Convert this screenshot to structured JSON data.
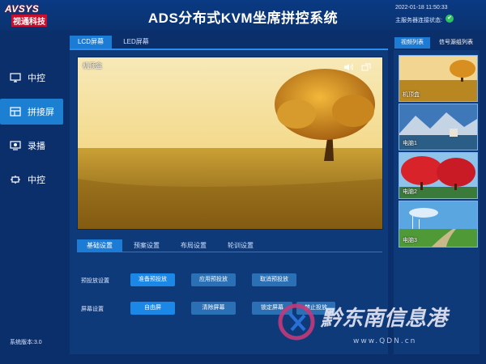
{
  "header": {
    "logo_text": "AVSYS",
    "logo_sub": "视通科技",
    "title": "ADS分布式KVM坐席拼控系统",
    "datetime": "2022-01-18 11:50:33",
    "server_status_label": "主服务器连接状态:"
  },
  "sidebar": {
    "items": [
      {
        "label": "中控",
        "icon": "monitor-icon",
        "active": false
      },
      {
        "label": "拼接屏",
        "icon": "splice-screen-icon",
        "active": true
      },
      {
        "label": "录播",
        "icon": "record-icon",
        "active": false
      },
      {
        "label": "中控",
        "icon": "control-icon",
        "active": false
      }
    ],
    "version": "系统版本:3.0"
  },
  "main": {
    "tabs": [
      "LCD屏幕",
      "LED屏幕"
    ],
    "active_tab": 0,
    "preview_label": "机顶盒",
    "sub_tabs": [
      "基础设置",
      "预案设置",
      "布局设置",
      "轮训设置"
    ],
    "active_sub_tab": 0,
    "rows": [
      {
        "label": "预投放设置",
        "buttons": [
          "准备预投放",
          "应用预投放",
          "取消预投放"
        ]
      },
      {
        "label": "屏幕设置",
        "buttons": [
          "自由屏",
          "清除屏幕",
          "锁定屏幕",
          "禁止投放"
        ]
      }
    ]
  },
  "right_panel": {
    "tabs": [
      "视频列表",
      "信号源组列表"
    ],
    "active_tab": 0,
    "thumbs": [
      "机顶盒",
      "电脑1",
      "电脑2",
      "电脑3"
    ]
  },
  "watermark": {
    "text": "黔东南信息港",
    "url": "www.QDN.cn"
  },
  "colors": {
    "background": "#0b2f6b",
    "panel": "#0e3a7a",
    "accent": "#1c7bd4",
    "status_ok": "#2ec262"
  }
}
